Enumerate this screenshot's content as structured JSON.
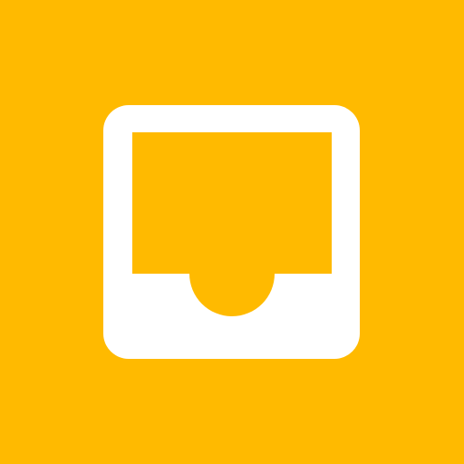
{
  "app_icon": {
    "icon": "inbox-icon",
    "colors": {
      "background": "#FFBA00",
      "glyph": "#FFFFFF"
    }
  }
}
